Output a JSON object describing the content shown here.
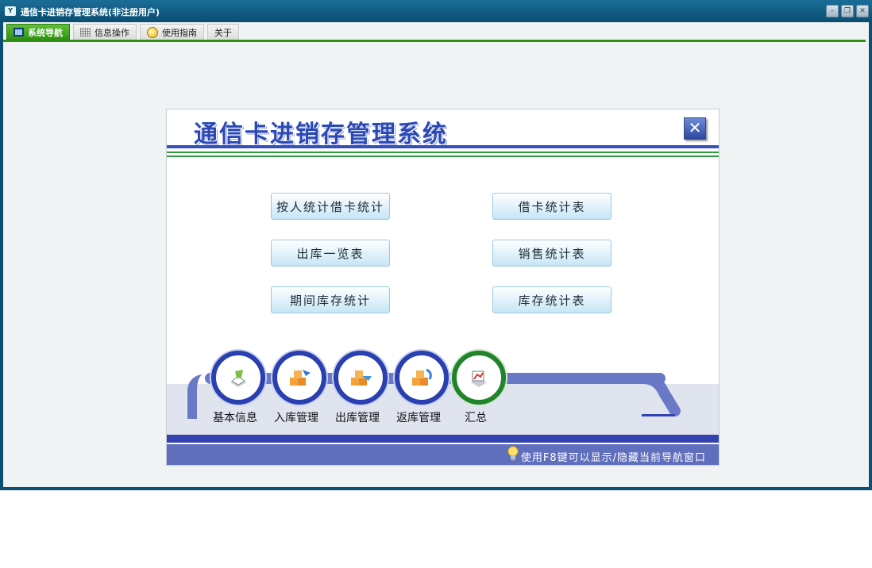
{
  "window": {
    "title": "通信卡进销存管理系统(非注册用户)",
    "icon": "app-logo-icon"
  },
  "tabs": [
    {
      "label": "系统导航",
      "icon": "monitor-icon",
      "active": true
    },
    {
      "label": "信息操作",
      "icon": "grid-icon",
      "active": false
    },
    {
      "label": "使用指南",
      "icon": "help-icon",
      "active": false
    },
    {
      "label": "关于",
      "icon": "",
      "active": false
    }
  ],
  "panel": {
    "title": "通信卡进销存管理系统",
    "reports": [
      "按人统计借卡统计",
      "借卡统计表",
      "出库一览表",
      "销售统计表",
      "期间库存统计",
      "库存统计表"
    ],
    "modules": [
      {
        "label": "基本信息",
        "icon": "basic-info-icon"
      },
      {
        "label": "入库管理",
        "icon": "stock-in-icon"
      },
      {
        "label": "出库管理",
        "icon": "stock-out-icon"
      },
      {
        "label": "返库管理",
        "icon": "return-icon"
      },
      {
        "label": "汇总",
        "icon": "summary-icon"
      }
    ],
    "footer_hint": "使用F8键可以显示/隐藏当前导航窗口"
  },
  "colors": {
    "title_bar": "#0b4e72",
    "active_tab": "#2f8f12",
    "panel_blue": "#2b49b6",
    "band_blue": "#3344b0"
  }
}
